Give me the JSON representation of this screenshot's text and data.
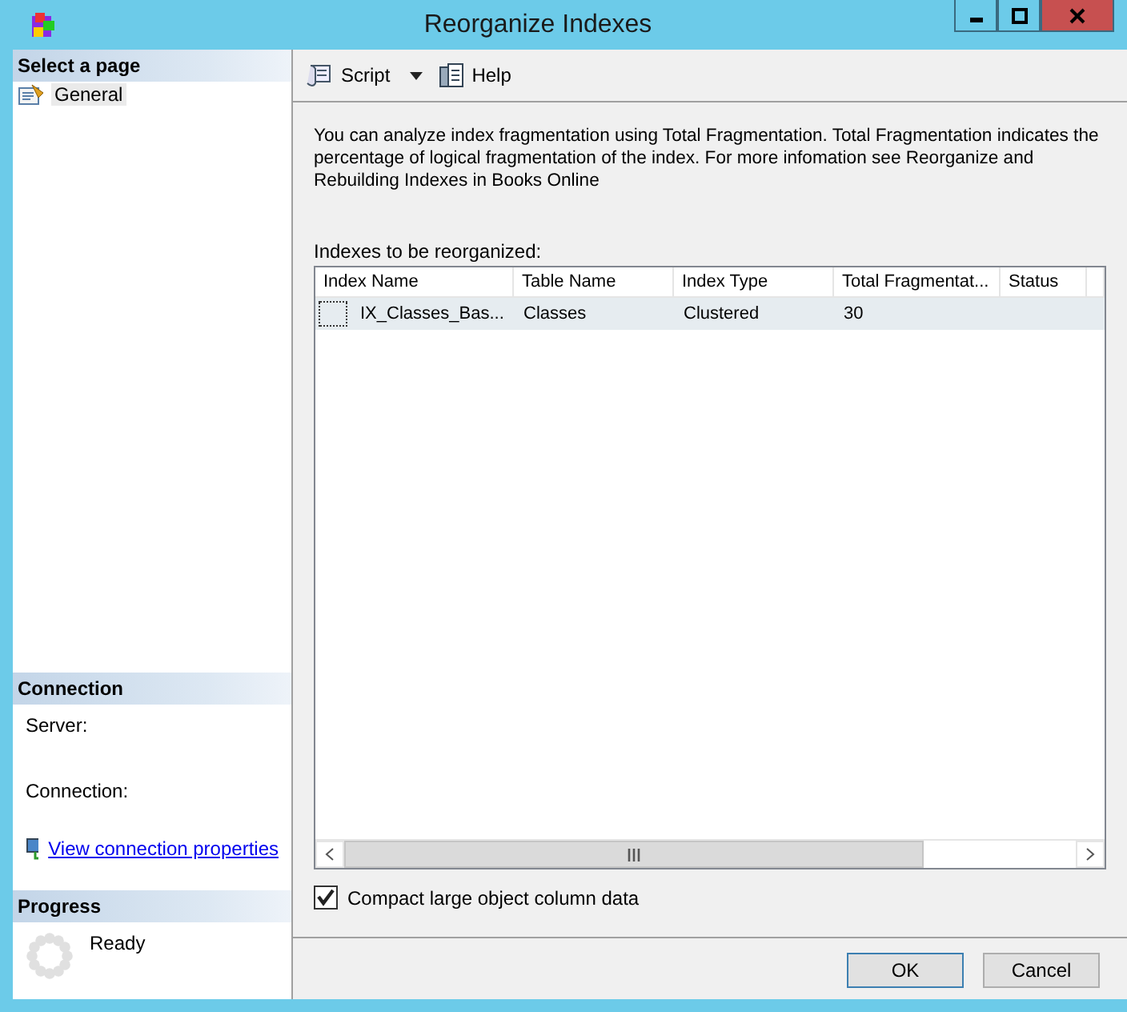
{
  "window": {
    "title": "Reorganize Indexes"
  },
  "sidebar": {
    "select_page": {
      "heading": "Select a page",
      "items": [
        {
          "label": "General",
          "selected": true
        }
      ]
    },
    "connection": {
      "heading": "Connection",
      "server_label": "Server:",
      "connection_label": "Connection:",
      "link": "View connection properties"
    },
    "progress": {
      "heading": "Progress",
      "status": "Ready"
    }
  },
  "toolbar": [
    {
      "label": "Script",
      "kind": "dropdown"
    },
    {
      "label": "Help",
      "kind": "button"
    }
  ],
  "description": "You can analyze index fragmentation using Total Fragmentation. Total Fragmentation indicates the percentage of logical fragmentation of the index. For more infomation see Reorganize and Rebuilding Indexes in Books Online",
  "table": {
    "label": "Indexes to be reorganized:",
    "columns": [
      "Index Name",
      "Table Name",
      "Index Type",
      "Total Fragmentat...",
      "Status"
    ],
    "rows": [
      {
        "checked": false,
        "selected": true,
        "cells": [
          "IX_Classes_Bas...",
          "Classes",
          "Clustered",
          "30"
        ]
      }
    ]
  },
  "compact_option": {
    "label": "Compact large object column data",
    "checked": true
  },
  "buttons": [
    "OK",
    "Cancel"
  ]
}
